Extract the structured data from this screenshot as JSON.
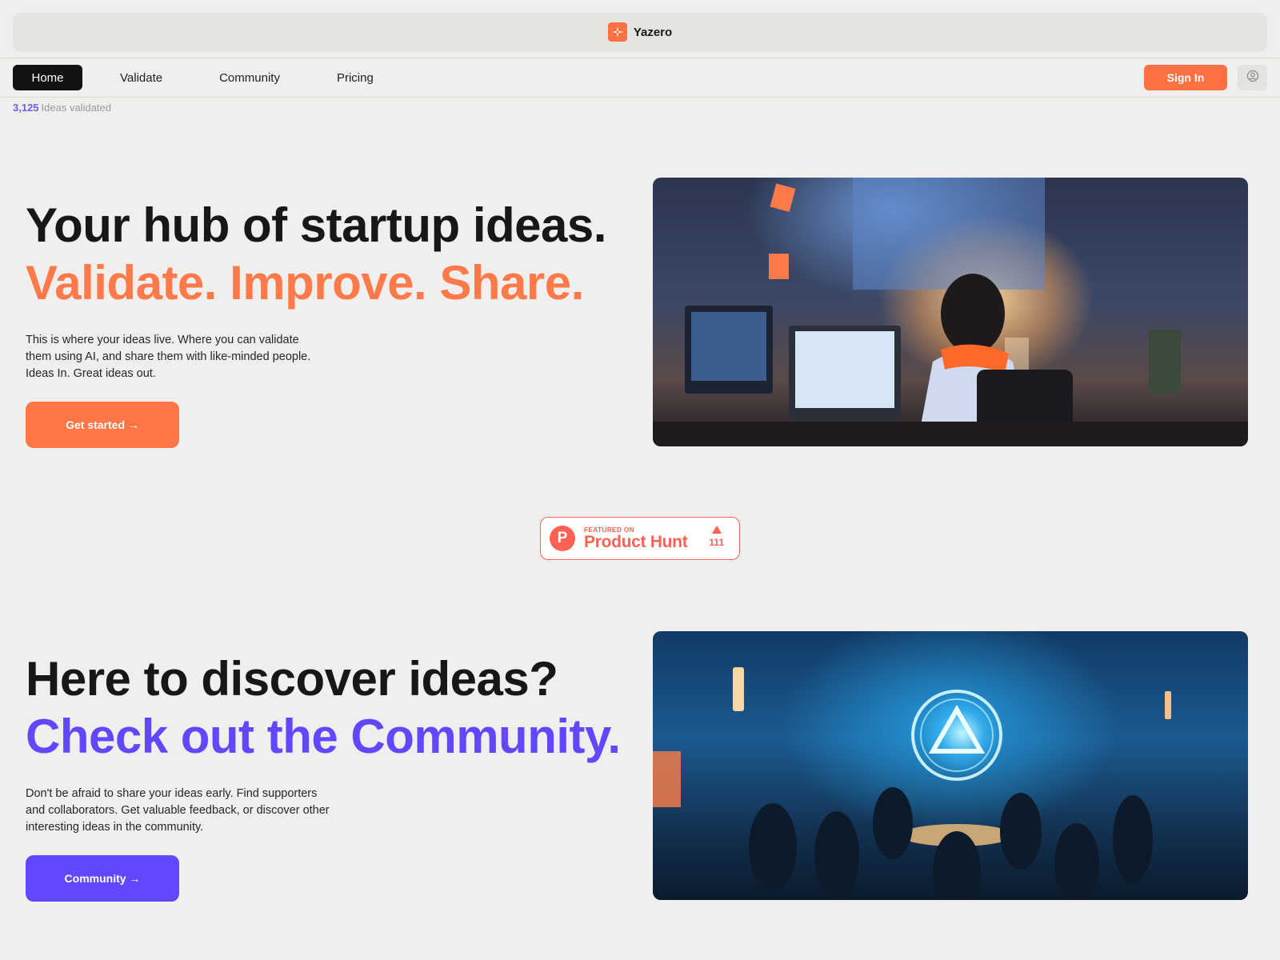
{
  "brand": {
    "name": "Yazero",
    "logo_icon": "sparkle-icon",
    "accent": "#ff7043"
  },
  "nav": {
    "items": [
      {
        "label": "Home",
        "active": true
      },
      {
        "label": "Validate",
        "active": false
      },
      {
        "label": "Community",
        "active": false
      },
      {
        "label": "Pricing",
        "active": false
      }
    ],
    "signin_label": "Sign In",
    "user_icon": "user-circle-icon"
  },
  "stat": {
    "count": "3,125",
    "label": "Ideas validated"
  },
  "hero": {
    "title_line1": "Your hub of startup ideas.",
    "title_line2": "Validate. Improve. Share.",
    "description": "This is where your ideas live. Where you can validate them using AI, and share them with like-minded people. Ideas In. Great ideas out.",
    "cta_label": "Get started →",
    "image_alt": "Anime illustration of a person working at computer monitors in a warmly lit room"
  },
  "product_hunt": {
    "featured_label": "FEATURED ON",
    "name": "Product Hunt",
    "logo_letter": "P",
    "votes": "111"
  },
  "community": {
    "title_line1": "Here to discover ideas?",
    "title_line2": "Check out the Community.",
    "description": "Don't be afraid to share your ideas early. Find supporters and collaborators. Get valuable feedback, or discover other interesting ideas in the community.",
    "cta_label": "Community →",
    "image_alt": "Anime illustration of a group gathered around a table beneath a glowing triangle emblem"
  },
  "colors": {
    "orange": "#ff7545",
    "purple": "#6148ff",
    "product_hunt": "#ff6154",
    "background": "#f0efed"
  }
}
